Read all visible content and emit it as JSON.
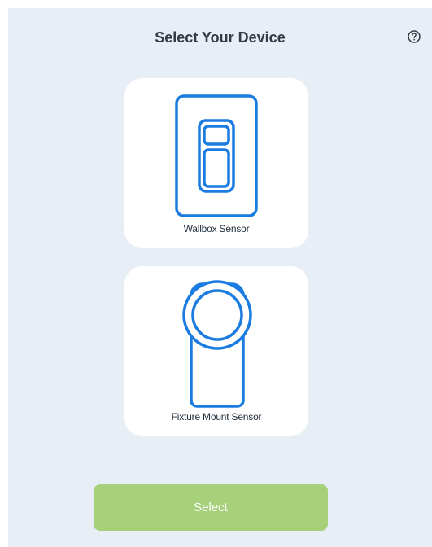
{
  "header": {
    "title": "Select Your Device",
    "help_icon": "help-circle-icon"
  },
  "devices": [
    {
      "label": "Wallbox Sensor",
      "icon": "wallbox-sensor-icon"
    },
    {
      "label": "Fixture Mount Sensor",
      "icon": "fixture-mount-sensor-icon"
    }
  ],
  "footer": {
    "select_label": "Select"
  },
  "colors": {
    "background": "#e8eef5",
    "card": "#ffffff",
    "icon_stroke": "#1a7be0",
    "button": "#a6d07a",
    "title": "#333a42"
  }
}
